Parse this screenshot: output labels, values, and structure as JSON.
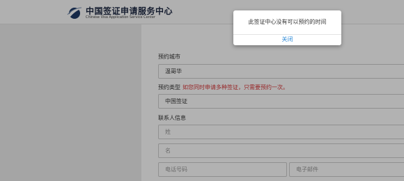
{
  "header": {
    "logo_cn": "中国签证申请服务中心",
    "logo_en": "Chinese Visa Application Service Center"
  },
  "form": {
    "city_label": "预约城市",
    "city_value": "温哥华",
    "type_label": "预约类型",
    "type_note": "如您同时申请多种签证，只需要预约一次。",
    "type_value": "中国签证",
    "contact_label": "联系人信息",
    "surname_placeholder": "姓",
    "given_name_placeholder": "名",
    "phone_placeholder": "电话号码",
    "email_placeholder": "电子邮件"
  },
  "dialog": {
    "message": "此签证中心没有可以预约的时间",
    "close_label": "关闭"
  },
  "colors": {
    "note_red": "#d9383a",
    "link_blue": "#2f8bd8",
    "logo_navy": "#1f2a44"
  }
}
